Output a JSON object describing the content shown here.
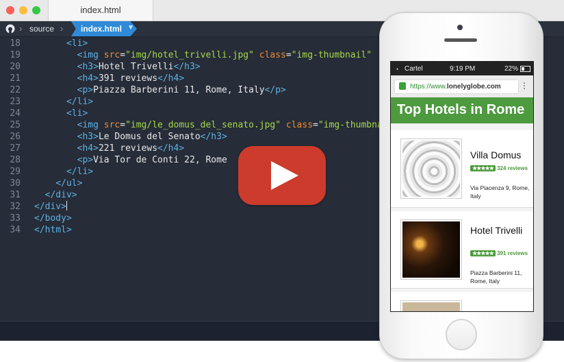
{
  "editor": {
    "tab_title": "index.html",
    "breadcrumb": {
      "folder": "source",
      "file": "index.html"
    },
    "lines": [
      {
        "n": "18",
        "indent": "      ",
        "parts": [
          {
            "t": "tag",
            "v": "<li>"
          }
        ]
      },
      {
        "n": "19",
        "indent": "        ",
        "parts": [
          {
            "t": "tag",
            "v": "<img "
          },
          {
            "t": "attr",
            "v": "src"
          },
          {
            "t": "txt",
            "v": "="
          },
          {
            "t": "str",
            "v": "\"img/hotel_trivelli.jpg\""
          },
          {
            "t": "txt",
            "v": " "
          },
          {
            "t": "attr",
            "v": "class"
          },
          {
            "t": "txt",
            "v": "="
          },
          {
            "t": "str",
            "v": "\"img-thumbnail\""
          }
        ]
      },
      {
        "n": "20",
        "indent": "        ",
        "parts": [
          {
            "t": "tag",
            "v": "<h3>"
          },
          {
            "t": "txt",
            "v": "Hotel Trivelli"
          },
          {
            "t": "tag",
            "v": "</h3>"
          }
        ]
      },
      {
        "n": "21",
        "indent": "        ",
        "parts": [
          {
            "t": "tag",
            "v": "<h4>"
          },
          {
            "t": "txt",
            "v": "391 reviews"
          },
          {
            "t": "tag",
            "v": "</h4>"
          }
        ]
      },
      {
        "n": "22",
        "indent": "        ",
        "parts": [
          {
            "t": "tag",
            "v": "<p>"
          },
          {
            "t": "txt",
            "v": "Piazza Barberini 11, Rome, Italy"
          },
          {
            "t": "tag",
            "v": "</p>"
          }
        ]
      },
      {
        "n": "23",
        "indent": "      ",
        "parts": [
          {
            "t": "tag",
            "v": "</li>"
          }
        ]
      },
      {
        "n": "24",
        "indent": "      ",
        "parts": [
          {
            "t": "tag",
            "v": "<li>"
          }
        ]
      },
      {
        "n": "25",
        "indent": "        ",
        "parts": [
          {
            "t": "tag",
            "v": "<img "
          },
          {
            "t": "attr",
            "v": "src"
          },
          {
            "t": "txt",
            "v": "="
          },
          {
            "t": "str",
            "v": "\"img/le_domus_del_senato.jpg\""
          },
          {
            "t": "txt",
            "v": " "
          },
          {
            "t": "attr",
            "v": "class"
          },
          {
            "t": "txt",
            "v": "="
          },
          {
            "t": "str",
            "v": "\"img-thumbnail\""
          }
        ]
      },
      {
        "n": "26",
        "indent": "        ",
        "parts": [
          {
            "t": "tag",
            "v": "<h3>"
          },
          {
            "t": "txt",
            "v": "Le Domus del Senato"
          },
          {
            "t": "tag",
            "v": "</h3>"
          }
        ]
      },
      {
        "n": "27",
        "indent": "        ",
        "parts": [
          {
            "t": "tag",
            "v": "<h4>"
          },
          {
            "t": "txt",
            "v": "221 reviews"
          },
          {
            "t": "tag",
            "v": "</h4>"
          }
        ]
      },
      {
        "n": "28",
        "indent": "        ",
        "parts": [
          {
            "t": "tag",
            "v": "<p>"
          },
          {
            "t": "txt",
            "v": "Via Tor de Conti 22, Rome"
          }
        ]
      },
      {
        "n": "29",
        "indent": "      ",
        "parts": [
          {
            "t": "tag",
            "v": "</li>"
          }
        ]
      },
      {
        "n": "30",
        "indent": "    ",
        "parts": [
          {
            "t": "tag",
            "v": "</ul>"
          }
        ]
      },
      {
        "n": "31",
        "indent": "  ",
        "parts": [
          {
            "t": "tag",
            "v": "</div>"
          }
        ]
      },
      {
        "n": "32",
        "indent": "",
        "parts": [
          {
            "t": "tag",
            "v": "</div>"
          },
          {
            "t": "caret",
            "v": ""
          }
        ]
      },
      {
        "n": "33",
        "indent": "",
        "parts": [
          {
            "t": "tag",
            "v": "</body>"
          }
        ]
      },
      {
        "n": "34",
        "indent": "",
        "parts": [
          {
            "t": "tag",
            "v": "</html>"
          }
        ]
      }
    ]
  },
  "phone": {
    "status": {
      "carrier": "Cartel",
      "time": "9:19 PM",
      "battery": "22%"
    },
    "url": {
      "scheme": "https://www.",
      "host": "lonelyglobe.com",
      "menu": "⋮"
    },
    "page_title": "Top Hotels in Rome",
    "hotels": [
      {
        "name": "Villa Domus",
        "stars": "★★★★★",
        "reviews": "324 reviews",
        "address": "Via Piacenza 9, Rome, Italy"
      },
      {
        "name": "Hotel Trivelli",
        "stars": "★★★★★",
        "reviews": "391 reviews",
        "address": "Piazza Barberini 11, Rome, Italy"
      }
    ]
  },
  "colors": {
    "editor_bg": "#262c38",
    "tag": "#5fb3e6",
    "attr": "#f08b2f",
    "string": "#a6d84a",
    "breadcrumb_active": "#2f8ad8",
    "header_green": "#4e9a3f",
    "play_red": "#cc3b2c"
  }
}
